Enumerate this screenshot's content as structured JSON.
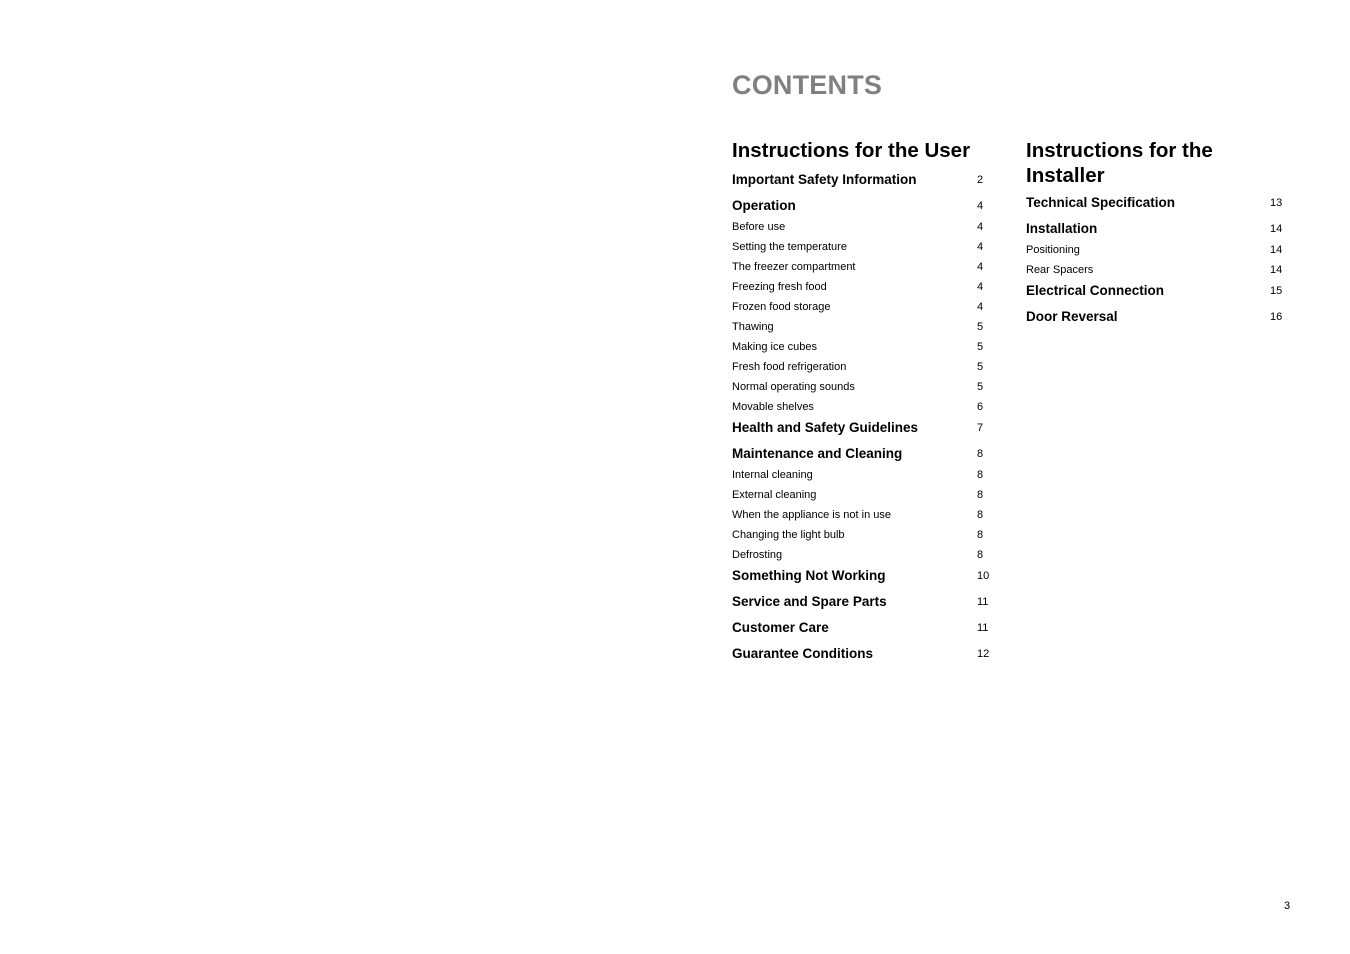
{
  "title": "CONTENTS",
  "user_section": {
    "heading": "Instructions for the User",
    "entries": [
      {
        "label": "Important Safety Information",
        "page": "2",
        "level": "major"
      },
      {
        "label": "Operation",
        "page": "4",
        "level": "major"
      },
      {
        "label": "Before use",
        "page": "4",
        "level": "minor"
      },
      {
        "label": "Setting the temperature",
        "page": "4",
        "level": "minor"
      },
      {
        "label": "The freezer compartment",
        "page": "4",
        "level": "minor"
      },
      {
        "label": "Freezing fresh food",
        "page": "4",
        "level": "minor"
      },
      {
        "label": "Frozen food storage",
        "page": "4",
        "level": "minor"
      },
      {
        "label": "Thawing",
        "page": "5",
        "level": "minor"
      },
      {
        "label": "Making ice cubes",
        "page": "5",
        "level": "minor"
      },
      {
        "label": "Fresh food refrigeration",
        "page": "5",
        "level": "minor"
      },
      {
        "label": "Normal operating sounds",
        "page": "5",
        "level": "minor"
      },
      {
        "label": "Movable shelves",
        "page": "6",
        "level": "minor"
      },
      {
        "label": "Health and Safety Guidelines",
        "page": "7",
        "level": "major"
      },
      {
        "label": "Maintenance and Cleaning",
        "page": "8",
        "level": "major"
      },
      {
        "label": "Internal cleaning",
        "page": "8",
        "level": "minor"
      },
      {
        "label": "External cleaning",
        "page": "8",
        "level": "minor"
      },
      {
        "label": "When the appliance is not in use",
        "page": "8",
        "level": "minor"
      },
      {
        "label": "Changing the light bulb",
        "page": "8",
        "level": "minor"
      },
      {
        "label": "Defrosting",
        "page": "8",
        "level": "minor"
      },
      {
        "label": "Something Not Working",
        "page": "10",
        "level": "major"
      },
      {
        "label": "Service and Spare Parts",
        "page": "11",
        "level": "major"
      },
      {
        "label": "Customer Care",
        "page": "11",
        "level": "major"
      },
      {
        "label": "Guarantee Conditions",
        "page": "12",
        "level": "major"
      }
    ]
  },
  "installer_section": {
    "heading_line1": "Instructions for the",
    "heading_line2": "Installer",
    "entries": [
      {
        "label": "Technical Specification",
        "page": "13",
        "level": "major"
      },
      {
        "label": "Installation",
        "page": "14",
        "level": "major"
      },
      {
        "label": "Positioning",
        "page": "14",
        "level": "minor"
      },
      {
        "label": "Rear Spacers",
        "page": "14",
        "level": "minor"
      },
      {
        "label": "Electrical Connection",
        "page": "15",
        "level": "major"
      },
      {
        "label": "Door Reversal",
        "page": "16",
        "level": "major"
      }
    ]
  },
  "page_number": "3"
}
